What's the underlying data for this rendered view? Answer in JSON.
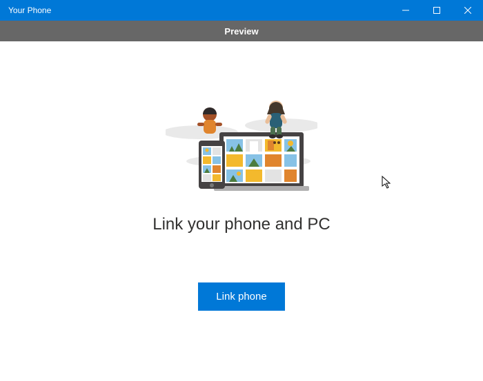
{
  "window": {
    "title": "Your Phone"
  },
  "preview_bar": {
    "label": "Preview"
  },
  "main": {
    "heading": "Link your phone and PC",
    "button_label": "Link phone"
  },
  "colors": {
    "accent": "#0078D7",
    "preview_bar": "#676767"
  }
}
